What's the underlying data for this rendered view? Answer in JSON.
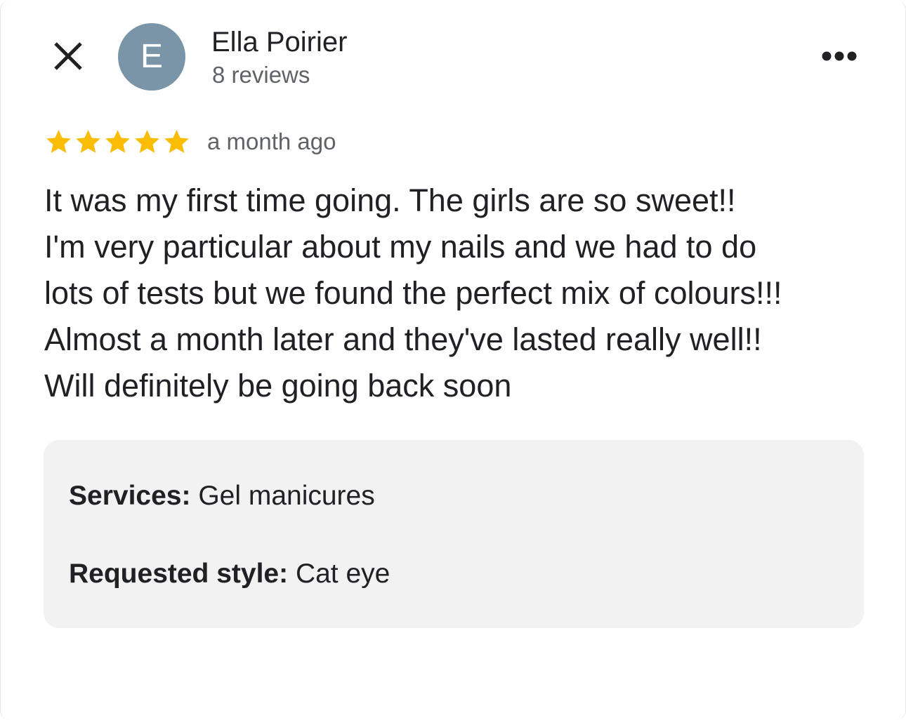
{
  "header": {
    "close_icon": "close-icon",
    "avatar_letter": "E",
    "avatar_color": "#7a95a7",
    "author_name": "Ella Poirier",
    "review_count": "8 reviews",
    "more_icon": "more-horizontal-icon"
  },
  "review": {
    "rating": 5,
    "rating_max": 5,
    "star_color": "#fbbc04",
    "time_ago": "a month ago",
    "lines": [
      "It was my first time going. The girls are so sweet!!",
      "I'm very particular about my nails and we had to do",
      "lots of tests but we found the perfect mix of colours!!!",
      "Almost a month later and they've lasted really well!!",
      "Will definitely be going back soon"
    ]
  },
  "details": {
    "services_label": "Services:",
    "services_value": "Gel manicures",
    "style_label": "Requested style:",
    "style_value": "Cat eye"
  }
}
